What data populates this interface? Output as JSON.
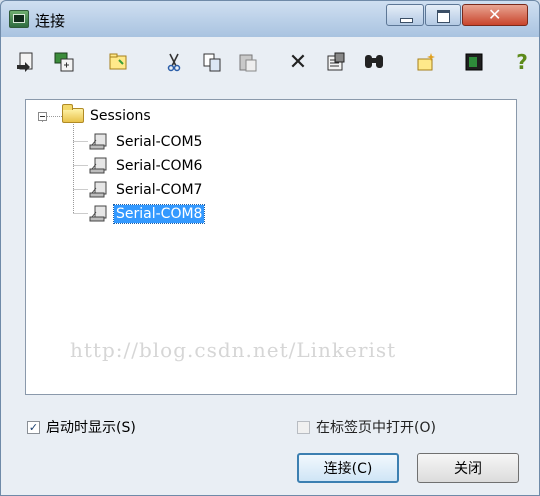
{
  "window": {
    "title": "连接"
  },
  "toolbar": {
    "items": [
      {
        "name": "quick-connect-icon",
        "glyph": "⤷"
      },
      {
        "name": "connect-in-tab-icon",
        "glyph": "⧉"
      },
      {
        "name": "new-folder-icon",
        "glyph": "▣"
      },
      {
        "name": "cut-icon",
        "glyph": "✂"
      },
      {
        "name": "copy-icon",
        "glyph": "⎘"
      },
      {
        "name": "paste-icon",
        "glyph": "⎗"
      },
      {
        "name": "delete-icon",
        "glyph": "✕"
      },
      {
        "name": "properties-icon",
        "glyph": "⚙"
      },
      {
        "name": "find-icon",
        "glyph": "⌕"
      },
      {
        "name": "new-session-icon",
        "glyph": "✦"
      },
      {
        "name": "terminal-icon",
        "glyph": "▦"
      },
      {
        "name": "help-icon",
        "glyph": "?"
      }
    ]
  },
  "tree": {
    "root_label": "Sessions",
    "sessions": [
      {
        "label": "Serial-COM5",
        "selected": false
      },
      {
        "label": "Serial-COM6",
        "selected": false
      },
      {
        "label": "Serial-COM7",
        "selected": false
      },
      {
        "label": "Serial-COM8",
        "selected": true
      }
    ],
    "watermark": "http://blog.csdn.net/Linkerist"
  },
  "options": {
    "show_on_startup": {
      "label": "启动时显示(S)",
      "checked": true
    },
    "open_in_tab": {
      "label": "在标签页中打开(O)",
      "checked": false,
      "enabled": false
    }
  },
  "buttons": {
    "connect": "连接(C)",
    "close": "关闭"
  }
}
